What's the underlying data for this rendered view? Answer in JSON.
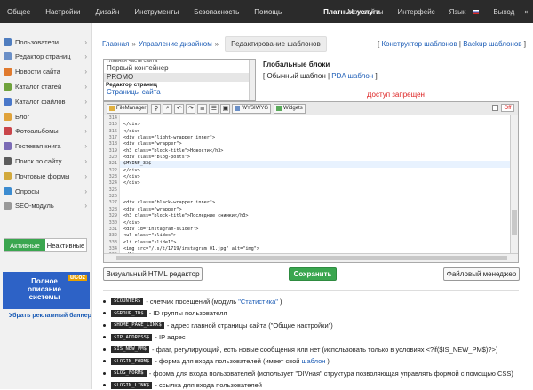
{
  "topbar": {
    "left": [
      {
        "label": "Общее",
        "name": "nav-general"
      },
      {
        "label": "Настройки",
        "name": "nav-settings"
      },
      {
        "label": "Дизайн",
        "name": "nav-design"
      },
      {
        "label": "Инструменты",
        "name": "nav-tools"
      },
      {
        "label": "Безопасность",
        "name": "nav-security"
      },
      {
        "label": "Помощь",
        "name": "nav-help"
      },
      {
        "label": "Платные услуги",
        "name": "nav-paid",
        "active": true
      }
    ],
    "my_sites": "Мои сайты",
    "interface": "Интерфейс",
    "language": "Язык",
    "logout": "Выход"
  },
  "sidebar": {
    "items": [
      {
        "label": "Пользователи",
        "color": "#4f7dbf",
        "name": "sidebar-item-users"
      },
      {
        "label": "Редактор страниц",
        "color": "#6a8fc7",
        "name": "sidebar-item-page-editor"
      },
      {
        "label": "Новости сайта",
        "color": "#e07a2e",
        "name": "sidebar-item-news"
      },
      {
        "label": "Каталог статей",
        "color": "#6fa23c",
        "name": "sidebar-item-articles"
      },
      {
        "label": "Каталог файлов",
        "color": "#4a78c9",
        "name": "sidebar-item-files"
      },
      {
        "label": "Блог",
        "color": "#e0a23a",
        "name": "sidebar-item-blog"
      },
      {
        "label": "Фотоальбомы",
        "color": "#c9454a",
        "name": "sidebar-item-photos"
      },
      {
        "label": "Гостевая книга",
        "color": "#7b6bb5",
        "name": "sidebar-item-guestbook"
      },
      {
        "label": "Поиск по сайту",
        "color": "#5c5c5c",
        "name": "sidebar-item-search"
      },
      {
        "label": "Почтовые формы",
        "color": "#d2a93c",
        "name": "sidebar-item-mailforms"
      },
      {
        "label": "Опросы",
        "color": "#3b8bd0",
        "name": "sidebar-item-polls"
      },
      {
        "label": "SEO-модуль",
        "color": "#999999",
        "name": "sidebar-item-seo"
      }
    ],
    "active_label": "Активные",
    "inactive_label": "Неактивные",
    "banner_text": "Полное описание системы",
    "banner_logo": "uCoz",
    "banner_link": "Убрать рекламный баннер"
  },
  "breadcrumbs": {
    "home": "Главная",
    "design": "Управление дизайном",
    "current": "Редактирование шаблонов"
  },
  "top_links": {
    "constructor": "Конструктор шаблонов",
    "backup": "Backup шаблонов"
  },
  "templates": {
    "cut_top": "Главная часть сайта",
    "items": [
      "Первый контейнер",
      "PROMO"
    ],
    "group": "Редактор страниц",
    "next": "Страницы сайта"
  },
  "global_blocks": {
    "title": "Глобальные блоки",
    "regular": "Обычный шаблон",
    "pda": "PDA шаблон"
  },
  "access_denied": "Доступ запрещен",
  "toolbar": {
    "filemanager": "FileManager",
    "wysiwyg": "WYSIWYG",
    "widgets": "Widgets",
    "off": "Off"
  },
  "code_lines": [
    {
      "n": "314",
      "t": ""
    },
    {
      "n": "315",
      "t": "</div>"
    },
    {
      "n": "316",
      "t": "</div>"
    },
    {
      "n": "317",
      "t": "<div class=\"light-wrapper inner\">"
    },
    {
      "n": "318",
      "t": "<div class=\"wrapper\">"
    },
    {
      "n": "319",
      "t": "<h3 class=\"block-title\">Новости</h3>"
    },
    {
      "n": "320",
      "t": "<div class=\"blog-posts\">"
    },
    {
      "n": "321",
      "t": "$MYINF_33$"
    },
    {
      "n": "322",
      "t": "</div>"
    },
    {
      "n": "323",
      "t": "</div>"
    },
    {
      "n": "324",
      "t": "</div>"
    },
    {
      "n": "325",
      "t": ""
    },
    {
      "n": "326",
      "t": ""
    },
    {
      "n": "327",
      "t": "<div class=\"black-wrapper inner\">"
    },
    {
      "n": "328",
      "t": "<div class=\"wrapper\">"
    },
    {
      "n": "329",
      "t": "<h3 class=\"block-title\">Последние снимки</h3>"
    },
    {
      "n": "330",
      "t": "</div>"
    },
    {
      "n": "331",
      "t": "<div id=\"instagram-slider\">"
    },
    {
      "n": "332",
      "t": "<ul class=\"slides\">"
    },
    {
      "n": "333",
      "t": "<li class=\"slide1\">"
    },
    {
      "n": "334",
      "t": "<img src=\"/.s/t/1719/instagram_01.jpg\" alt=\"img\">"
    },
    {
      "n": "335",
      "t": "</li>"
    },
    {
      "n": "336",
      "t": "<li class=\"slide2\">"
    }
  ],
  "highlight_line": "321",
  "buttons": {
    "visual": "Визуальный HTML редактор",
    "save": "Сохранить",
    "filemanager": "Файловый менеджер"
  },
  "vars": [
    {
      "tag": "$COUNTER$",
      "pre": "- счетчик посещений (модуль ",
      "link": "\"Статистика\"",
      "post": ")"
    },
    {
      "tag": "$GROUP_ID$",
      "pre": "- ID группы пользователя",
      "link": "",
      "post": ""
    },
    {
      "tag": "$HOME_PAGE_LINK$",
      "pre": "- адрес главной страницы сайта (\"Общие настройки\")",
      "link": "",
      "post": ""
    },
    {
      "tag": "$IP_ADDRESS$",
      "pre": "- IP адрес",
      "link": "",
      "post": ""
    },
    {
      "tag": "$IS_NEW_PM$",
      "pre": "- флаг, регулирующий, есть новые сообщения или нет (использовать только в условиях <?if($IS_NEW_PM$)?>)",
      "link": "",
      "post": ""
    },
    {
      "tag": "$LOGIN_FORM$",
      "pre": "- форма для входа пользователей (имеет свой ",
      "link": "шаблон",
      "post": ")"
    },
    {
      "tag": "$LOG_FORM$",
      "pre": "- форма для входа пользователей (использует \"DIVная\" структура позволяющая управлять формой с помощью CSS)",
      "link": "",
      "post": ""
    },
    {
      "tag": "$LOGIN_LINK$",
      "pre": "- ссылка для входа пользователей",
      "link": "",
      "post": ""
    }
  ]
}
